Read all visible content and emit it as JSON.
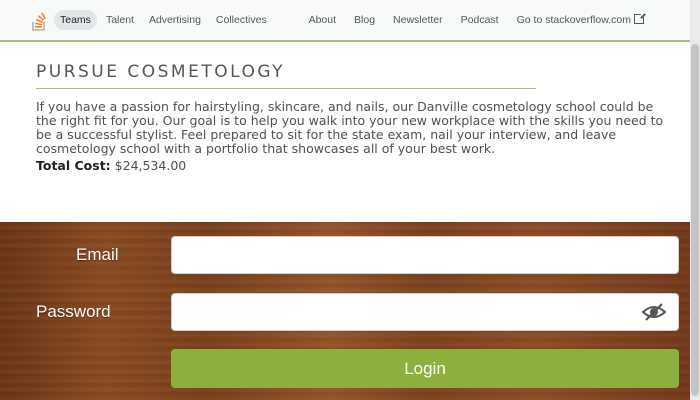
{
  "nav": {
    "left_links": [
      "Teams",
      "Talent",
      "Advertising",
      "Collectives"
    ],
    "right_links": [
      "About",
      "Blog",
      "Newsletter",
      "Podcast",
      "Go to stackoverflow.com"
    ],
    "logo_icon": "stackoverflow-logo-icon",
    "accent_color": "#a7bf6e"
  },
  "main": {
    "title": "PURSUE COSMETOLOGY",
    "description": "If you have a passion for hairstyling, skincare, and nails, our Danville cosmetology school could be the right fit for you. Our goal is to help you walk into your new workplace with the skills you need to be a successful stylist. Feel prepared to sit for the state exam, nail your interview, and leave cosmetology school with a portfolio that showcases all of your best work.",
    "cost_label": "Total Cost:",
    "cost_value": "$24,534.00"
  },
  "login": {
    "email_label": "Email",
    "email_value": "",
    "password_label": "Password",
    "password_value": "",
    "eye_icon": "eye-slash-icon",
    "login_label": "Login",
    "button_color": "#8bb03c"
  }
}
